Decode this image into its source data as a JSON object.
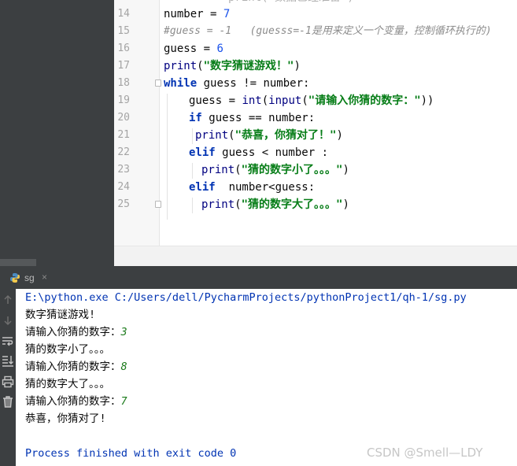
{
  "editor": {
    "first_line_fragment": "print(\"数据已经准备\")",
    "lines": [
      {
        "no": "14",
        "text": "number = 7"
      },
      {
        "no": "15",
        "text": "#guess = -1   (guesss=-1是用来定义一个变量，控制循环执行的)"
      },
      {
        "no": "16",
        "text": "guess = 6"
      },
      {
        "no": "17",
        "text": "print(\"数字猜谜游戏！\")"
      },
      {
        "no": "18",
        "text": "while guess != number:"
      },
      {
        "no": "19",
        "text": "guess = int(input(\"请输入你猜的数字：\"))"
      },
      {
        "no": "20",
        "text": "if guess == number:"
      },
      {
        "no": "21",
        "text": "print(\"恭喜，你猜对了！\")"
      },
      {
        "no": "22",
        "text": "elif guess < number :"
      },
      {
        "no": "23",
        "text": "print(\"猜的数字小了。。。\")"
      },
      {
        "no": "24",
        "text": "elif  number<guess:"
      },
      {
        "no": "25",
        "text": "print(\"猜的数字大了。。。\")"
      }
    ],
    "tokens": {
      "l14_a": "number",
      "l14_b": " = ",
      "l14_c": "7",
      "l15": "#guess = -1   (guesss=-1是用来定义一个变量，控制循环执行的)",
      "l16_a": "guess",
      "l16_b": " = ",
      "l16_c": "6",
      "l17_fn": "print",
      "l17_s": "\"数字猜谜游戏！\"",
      "l18_kw": "while",
      "l18_rest": " guess != number:",
      "l19_a": "guess = ",
      "l19_int": "int",
      "l19_inp": "input",
      "l19_s": "\"请输入你猜的数字：\"",
      "l20_kw": "if",
      "l20_rest": " guess == number:",
      "l21_fn": "print",
      "l21_s": "\"恭喜，你猜对了！\"",
      "l22_kw": "elif",
      "l22_rest": " guess < number :",
      "l23_fn": "print",
      "l23_s": "\"猜的数字小了。。。\"",
      "l24_kw": "elif",
      "l24_rest": "  number<guess:",
      "l25_fn": "print",
      "l25_s": "\"猜的数字大了。。。\""
    }
  },
  "run": {
    "tab_label": "sg",
    "tab_close": "×",
    "console": {
      "command": "E:\\python.exe C:/Users/dell/PycharmProjects/pythonProject1/qh-1/sg.py",
      "lines": [
        {
          "text": "数字猜谜游戏!"
        },
        {
          "prompt": "请输入你猜的数字：",
          "input": "3"
        },
        {
          "text": "猜的数字小了。。。"
        },
        {
          "prompt": "请输入你猜的数字：",
          "input": "8"
        },
        {
          "text": "猜的数字大了。。。"
        },
        {
          "prompt": "请输入你猜的数字：",
          "input": "7"
        },
        {
          "text": "恭喜，你猜对了!"
        }
      ],
      "finished": "Process finished with exit code 0"
    }
  },
  "watermark": "CSDN @Smell—LDY",
  "icons": {
    "run_tab": "python-icon",
    "toolbar": [
      "up-arrow-icon",
      "down-arrow-icon",
      "soft-wrap-icon",
      "scroll-to-end-icon",
      "print-icon",
      "trash-icon"
    ]
  },
  "colors": {
    "keyword": "#0033b3",
    "string": "#067d17",
    "number": "#1750eb",
    "comment": "#8c8c8c",
    "dark_panel": "#3c3f41",
    "console_input": "#1a7a1a"
  }
}
